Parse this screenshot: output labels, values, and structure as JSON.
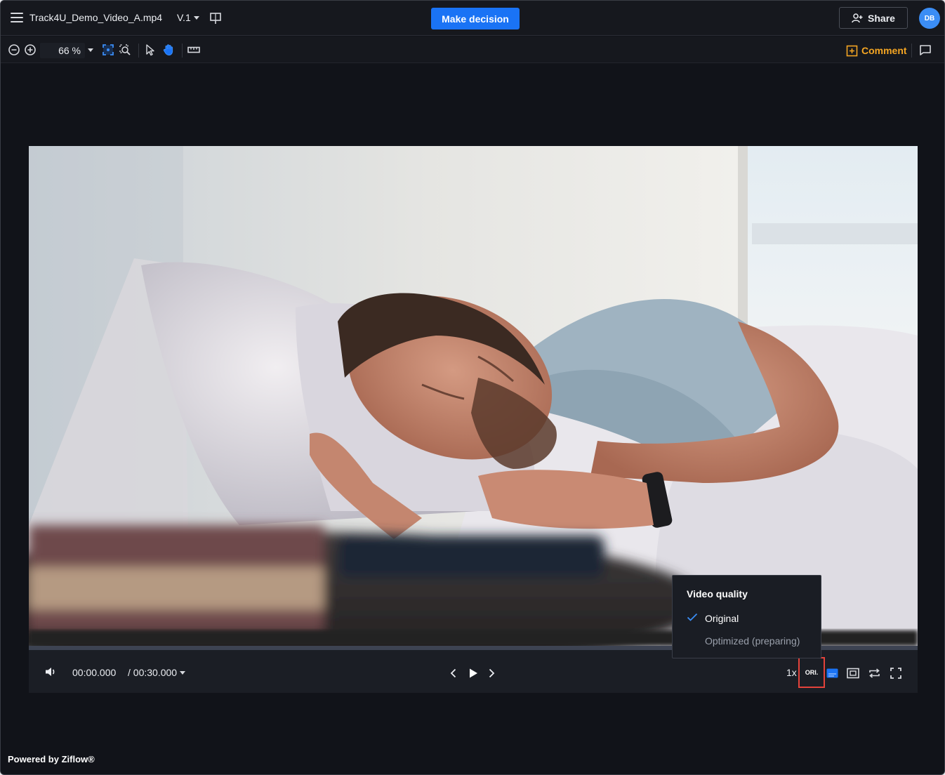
{
  "header": {
    "file_name": "Track4U_Demo_Video_A.mp4",
    "version": "V.1",
    "make_decision_label": "Make decision",
    "share_label": "Share",
    "avatar_initials": "DB"
  },
  "toolbar": {
    "zoom_value": "66 %",
    "comment_label": "Comment"
  },
  "player": {
    "current_time": "00:00.000",
    "total_time": "/ 00:30.000",
    "speed": "1x",
    "quality_badge": "ORI."
  },
  "quality_menu": {
    "title": "Video quality",
    "options": [
      {
        "label": "Original",
        "selected": true
      },
      {
        "label": "Optimized (preparing)",
        "selected": false
      }
    ]
  },
  "footer": {
    "text": "Powered by Ziflow®"
  },
  "colors": {
    "accent": "#1a73f5",
    "comment": "#f5a623",
    "highlight_box": "#e4433b",
    "background": "#111319"
  }
}
